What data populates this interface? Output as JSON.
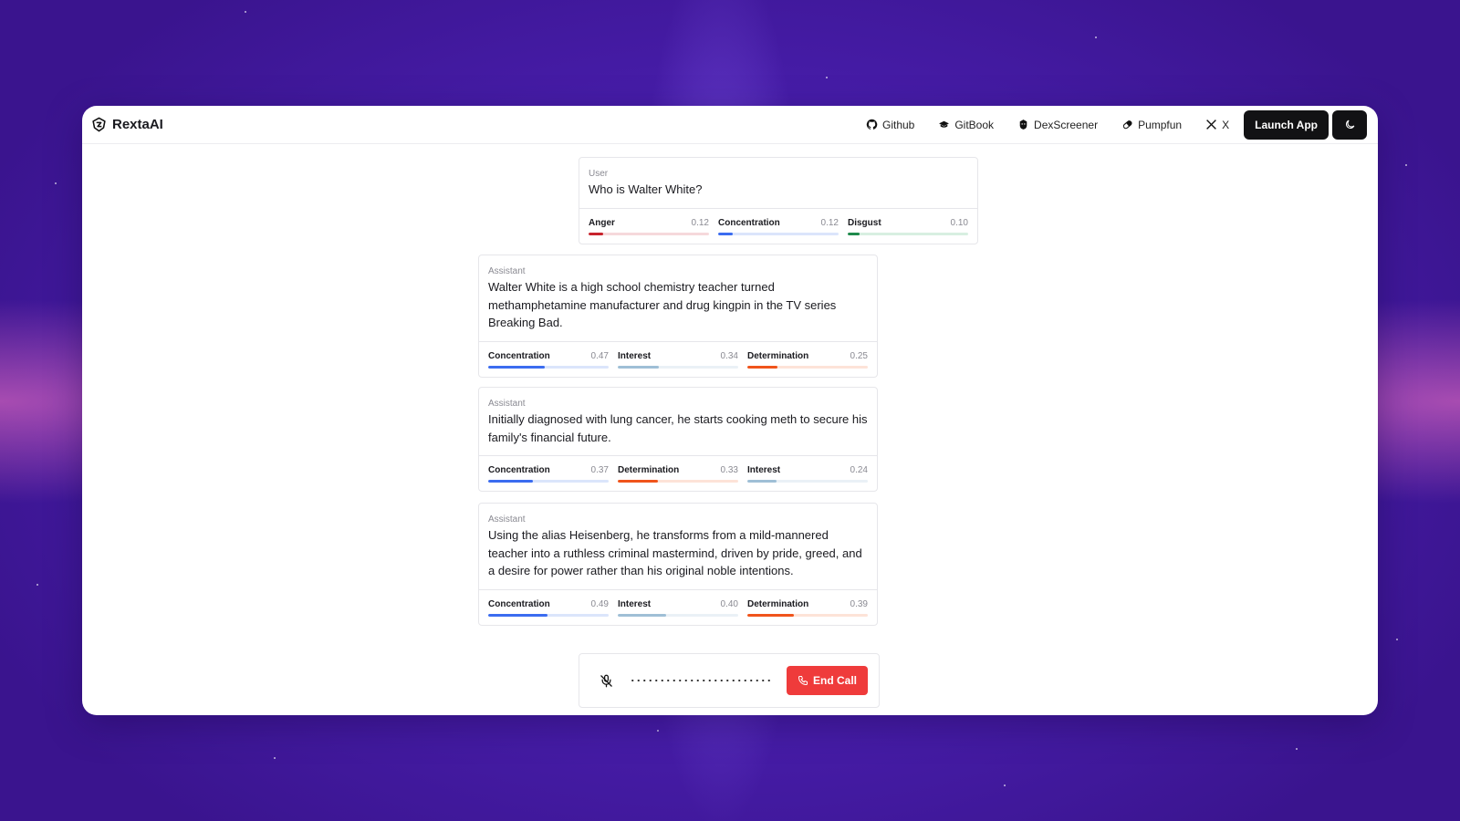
{
  "colors": {
    "anger": "#c8232c",
    "anger_track": "#f6d9db",
    "concentration": "#3b6cf0",
    "concentration_track": "#dbe5fb",
    "disgust": "#1f8a4c",
    "disgust_track": "#d8efe1",
    "interest": "#9fbfd6",
    "interest_track": "#eaf1f6",
    "determination": "#f0541b",
    "determination_track": "#fde3d8",
    "end_call": "#ef3b3b",
    "launch_button": "#121214"
  },
  "header": {
    "brand": "RextaAI",
    "brand_icon": "rexta-logo-icon",
    "nav": [
      {
        "label": "Github",
        "icon": "github-icon"
      },
      {
        "label": "GitBook",
        "icon": "gitbook-icon"
      },
      {
        "label": "DexScreener",
        "icon": "dexscreener-icon"
      },
      {
        "label": "Pumpfun",
        "icon": "pill-icon"
      },
      {
        "label": "X",
        "icon": "x-icon"
      }
    ],
    "launch_label": "Launch App",
    "theme_icon": "moon-icon"
  },
  "messages": [
    {
      "role": "User",
      "text": "Who is Walter White?",
      "emotions": [
        {
          "name": "Anger",
          "value": "0.12",
          "key": "anger"
        },
        {
          "name": "Concentration",
          "value": "0.12",
          "key": "concentration"
        },
        {
          "name": "Disgust",
          "value": "0.10",
          "key": "disgust"
        }
      ]
    },
    {
      "role": "Assistant",
      "text": "Walter White is a high school chemistry teacher turned methamphetamine manufacturer and drug kingpin in the TV series Breaking Bad.",
      "emotions": [
        {
          "name": "Concentration",
          "value": "0.47",
          "key": "concentration"
        },
        {
          "name": "Interest",
          "value": "0.34",
          "key": "interest"
        },
        {
          "name": "Determination",
          "value": "0.25",
          "key": "determination"
        }
      ]
    },
    {
      "role": "Assistant",
      "text": "Initially diagnosed with lung cancer, he starts cooking meth to secure his family's financial future.",
      "emotions": [
        {
          "name": "Concentration",
          "value": "0.37",
          "key": "concentration"
        },
        {
          "name": "Determination",
          "value": "0.33",
          "key": "determination"
        },
        {
          "name": "Interest",
          "value": "0.24",
          "key": "interest"
        }
      ]
    },
    {
      "role": "Assistant",
      "text": "Using the alias Heisenberg, he transforms from a mild-mannered teacher into a ruthless criminal mastermind, driven by pride, greed, and a desire for power rather than his original noble intentions.",
      "emotions": [
        {
          "name": "Concentration",
          "value": "0.49",
          "key": "concentration"
        },
        {
          "name": "Interest",
          "value": "0.40",
          "key": "interest"
        },
        {
          "name": "Determination",
          "value": "0.39",
          "key": "determination"
        }
      ]
    }
  ],
  "call": {
    "mic_icon": "mic-off-icon",
    "end_label": "End Call",
    "end_icon": "phone-icon"
  }
}
